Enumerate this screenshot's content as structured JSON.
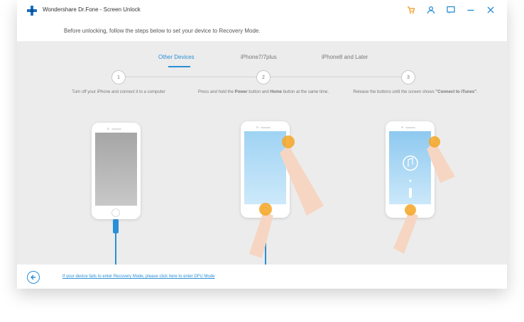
{
  "window": {
    "title": "Wondershare Dr.Fone - Screen Unlock"
  },
  "titlebar_icons": [
    "cart-icon",
    "user-icon",
    "feedback-icon",
    "minimize-icon",
    "close-icon"
  ],
  "instruction": "Before unlocking, follow the steps below to set your device to Recovery Mode.",
  "tabs": [
    {
      "label": "Other Devices",
      "active": true
    },
    {
      "label": "iPhone7/7plus",
      "active": false
    },
    {
      "label": "iPhone8 and Later",
      "active": false
    }
  ],
  "steps": [
    {
      "number": "1",
      "text": "Turn off your iPhone and connect it to a computer"
    },
    {
      "number": "2",
      "text_pre": "Press and hold the ",
      "bold1": "Power",
      "text_mid": " button and ",
      "bold2": "Home",
      "text_post": " button at the same time."
    },
    {
      "number": "3",
      "text_pre": "Release the buttons until the screen shows ",
      "bold1": "\"Connect to iTunes\"",
      "text_post": "."
    }
  ],
  "footer": {
    "dfu_link": "If your device fails to enter Recovery Mode, please click here to enter DFU Mode"
  },
  "colors": {
    "accent": "#2a8fd6",
    "tap": "#f5a623",
    "content_bg": "#ececec"
  }
}
